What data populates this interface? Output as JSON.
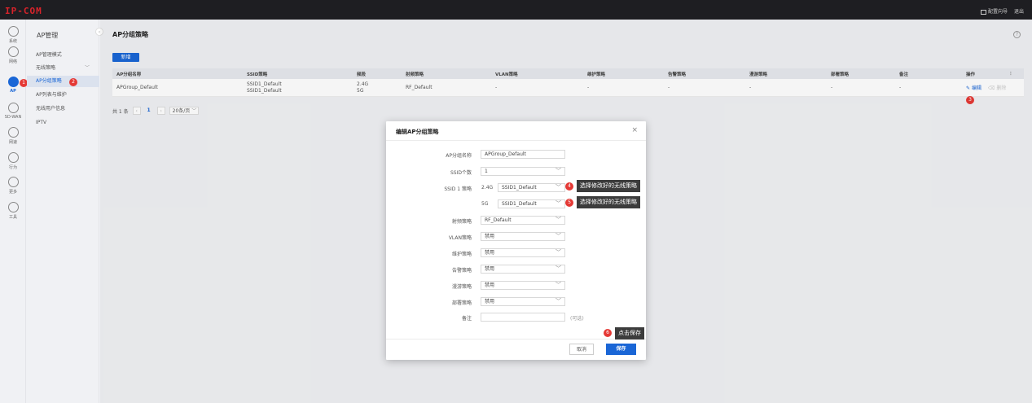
{
  "brand": {
    "logo": "IP-COM",
    "logo_color": "#d8232a",
    "accent": "#1a66d6",
    "badge_color": "#e53935"
  },
  "topbar": {
    "wizard": "配置向导",
    "logout": "退出"
  },
  "leftnav": [
    {
      "label": "系统",
      "icon": "dashboard-icon"
    },
    {
      "label": "网络",
      "icon": "network-icon"
    },
    {
      "label": "AP",
      "icon": "ap-icon",
      "active": true,
      "badge": "1"
    },
    {
      "label": "SD-WAN",
      "icon": "sdwan-icon"
    },
    {
      "label": "网速",
      "icon": "speed-icon"
    },
    {
      "label": "行为",
      "icon": "behavior-icon"
    },
    {
      "label": "更多",
      "icon": "more-icon"
    },
    {
      "label": "工具",
      "icon": "tools-icon"
    }
  ],
  "subnav": {
    "title": "AP管理",
    "collapse": "‹",
    "items": [
      {
        "label": "AP管理模式"
      },
      {
        "label": "无线策略",
        "chevron": "﹀"
      },
      {
        "label": "AP分组策略",
        "active": true,
        "badge": "2"
      },
      {
        "label": "AP列表与维护"
      },
      {
        "label": "无线用户信息"
      },
      {
        "label": "IPTV"
      }
    ]
  },
  "main": {
    "title": "AP分组策略",
    "help": "?",
    "add_button": "新增",
    "table": {
      "columns": [
        "AP分组名称",
        "SSID策略",
        "频段",
        "射频策略",
        "VLAN策略",
        "维护策略",
        "告警策略",
        "漫游策略",
        "部署策略",
        "备注",
        "操作"
      ],
      "rows": [
        {
          "name": "APGroup_Default",
          "ssid1": "SSID1_Default",
          "ssid2": "SSID1_Default",
          "band1": "2.4G",
          "band2": "5G",
          "rf": "RF_Default",
          "vlan": "-",
          "maint": "-",
          "alarm": "-",
          "roam": "-",
          "deploy": "-",
          "note": "-",
          "edit": "编辑",
          "delete": "删除",
          "badge": "3"
        }
      ]
    },
    "pager": {
      "total": "共 1 条",
      "prev": "‹",
      "page": "1",
      "next": "›",
      "size": "20条/页"
    }
  },
  "dialog": {
    "title": "编辑AP分组策略",
    "close": "×",
    "fields": {
      "group_name": {
        "label": "AP分组名称",
        "value": "APGroup_Default"
      },
      "ssid_count": {
        "label": "SSID个数",
        "value": "1"
      },
      "ssid1": {
        "label": "SSID 1 策略",
        "band24": "2.4G",
        "value24": "SSID1_Default",
        "band5": "5G",
        "value5": "SSID1_Default"
      },
      "rf": {
        "label": "射频策略",
        "value": "RF_Default"
      },
      "vlan": {
        "label": "VLAN策略",
        "value": "禁用"
      },
      "maint": {
        "label": "维护策略",
        "value": "禁用"
      },
      "alarm": {
        "label": "告警策略",
        "value": "禁用"
      },
      "roam": {
        "label": "漫游策略",
        "value": "禁用"
      },
      "deploy": {
        "label": "部署策略",
        "value": "禁用"
      },
      "note": {
        "label": "备注",
        "value": "",
        "hint": "(可选)"
      }
    },
    "cancel": "取消",
    "save": "保存"
  },
  "callouts": [
    {
      "badge": "4",
      "text": "选择修改好的无线策略"
    },
    {
      "badge": "5",
      "text": "选择修改好的无线策略"
    },
    {
      "badge": "6",
      "text": "点击保存"
    }
  ]
}
